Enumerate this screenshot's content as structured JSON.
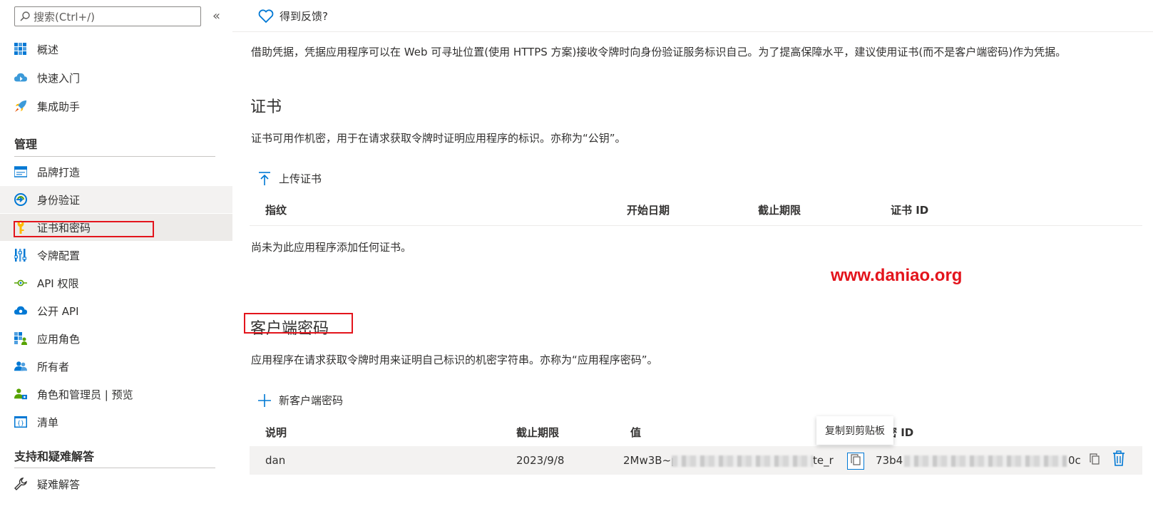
{
  "sidebar": {
    "search_placeholder": "搜索(Ctrl+/)",
    "collapse_glyph": "«",
    "items_top": [
      {
        "label": "概述",
        "icon": "overview-grid-icon"
      },
      {
        "label": "快速入门",
        "icon": "cloud-quickstart-icon"
      },
      {
        "label": "集成助手",
        "icon": "rocket-icon"
      }
    ],
    "manage_title": "管理",
    "items_manage": [
      {
        "label": "品牌打造",
        "icon": "branding-icon"
      },
      {
        "label": "身份验证",
        "icon": "authentication-icon"
      },
      {
        "label": "证书和密码",
        "icon": "key-icon"
      },
      {
        "label": "令牌配置",
        "icon": "token-config-icon"
      },
      {
        "label": "API 权限",
        "icon": "api-permissions-icon"
      },
      {
        "label": "公开 API",
        "icon": "cloud-api-icon"
      },
      {
        "label": "应用角色",
        "icon": "app-roles-icon"
      },
      {
        "label": "所有者",
        "icon": "owners-icon"
      },
      {
        "label": "角色和管理员 | 预览",
        "icon": "roles-admins-icon"
      },
      {
        "label": "清单",
        "icon": "manifest-icon"
      }
    ],
    "support_title": "支持和疑难解答",
    "items_support": [
      {
        "label": "疑难解答",
        "icon": "wrench-icon"
      }
    ]
  },
  "main": {
    "feedback_label": "得到反馈?",
    "intro": "借助凭据，凭据应用程序可以在 Web 可寻址位置(使用 HTTPS 方案)接收令牌时向身份验证服务标识自己。为了提高保障水平，建议使用证书(而不是客户端密码)作为凭据。",
    "certs": {
      "title": "证书",
      "description": "证书可用作机密，用于在请求获取令牌时证明应用程序的标识。亦称为“公钥”。",
      "upload_label": "上传证书",
      "columns": [
        "指纹",
        "开始日期",
        "截止期限",
        "证书 ID"
      ],
      "empty_text": "尚未为此应用程序添加任何证书。"
    },
    "watermark": "www.daniao.org",
    "secrets": {
      "title": "客户端密码",
      "description": "应用程序在请求获取令牌时用来证明自己标识的机密字符串。亦称为“应用程序密码”。",
      "new_label": "新客户端密码",
      "columns": [
        "说明",
        "截止期限",
        "值",
        "密 ID"
      ],
      "rows": [
        {
          "description": "dan",
          "expires": "2023/9/8",
          "value_start": "2Mw3B~p",
          "value_end": "te_r",
          "id_start": "73b4",
          "id_end": "0c"
        }
      ],
      "tooltip": "复制到剪贴板"
    }
  },
  "colors": {
    "accent": "#0078d4",
    "highlight": "#e3141c",
    "selected_bg": "#edebe9"
  }
}
